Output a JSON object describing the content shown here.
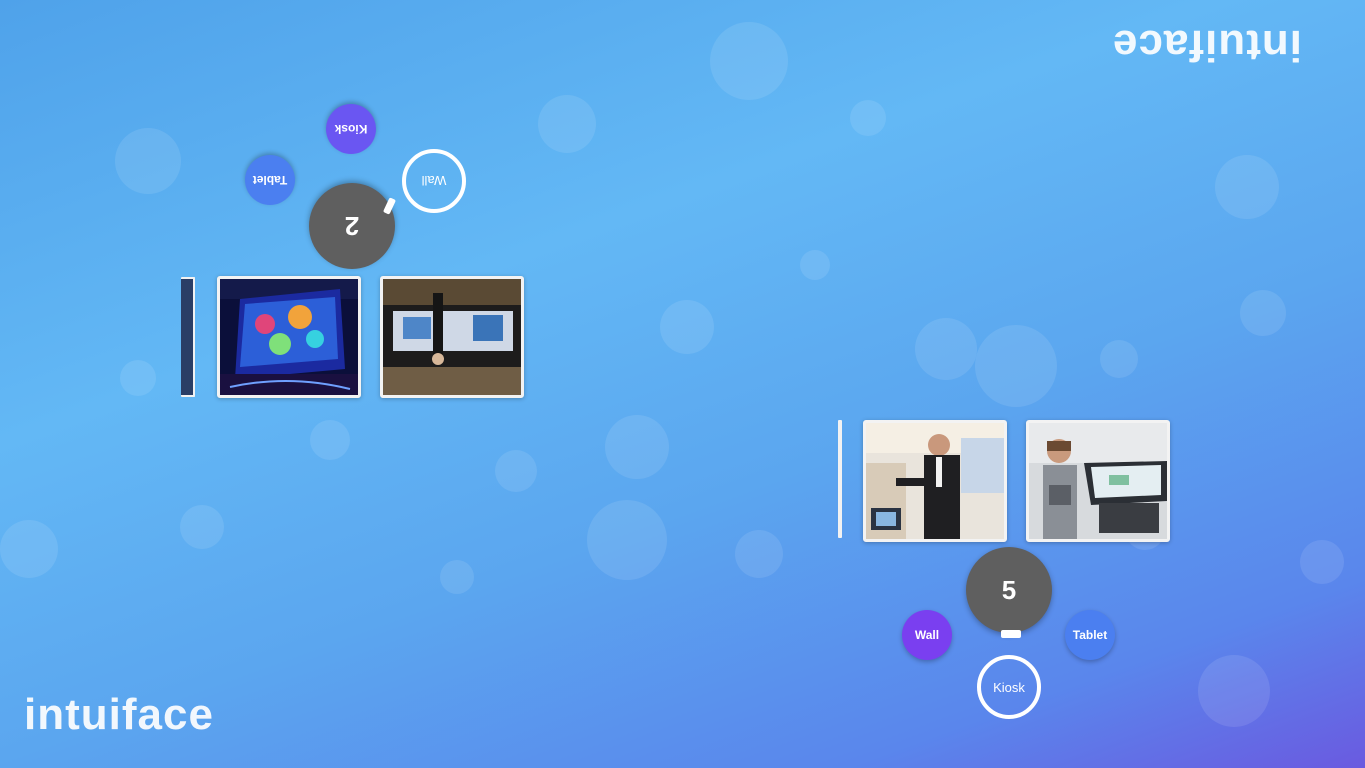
{
  "brand": {
    "logo_text": "intuiface"
  },
  "colors": {
    "wall_chip": "#7a3ff0",
    "kiosk_chip": "#6a56f2",
    "tablet_chip": "#4b7ff0",
    "hub": "#5f5f5f",
    "frame": "#f3f3f3"
  },
  "top_group": {
    "orientation": "rotated-180",
    "count": "2",
    "filters": [
      {
        "label": "Wall",
        "active": true
      },
      {
        "label": "Kiosk",
        "active": false
      },
      {
        "label": "Tablet",
        "active": false
      }
    ],
    "thumbnails": [
      {
        "subject": "interactive-video-wall-night"
      },
      {
        "subject": "man-at-large-display-wall"
      }
    ]
  },
  "bottom_group": {
    "orientation": "upright",
    "count": "5",
    "filters": [
      {
        "label": "Kiosk",
        "active": true
      },
      {
        "label": "Wall",
        "active": false
      },
      {
        "label": "Tablet",
        "active": false
      }
    ],
    "thumbnails": [
      {
        "subject": "man-using-kiosk-in-mall"
      },
      {
        "subject": "woman-using-touch-table"
      }
    ]
  }
}
